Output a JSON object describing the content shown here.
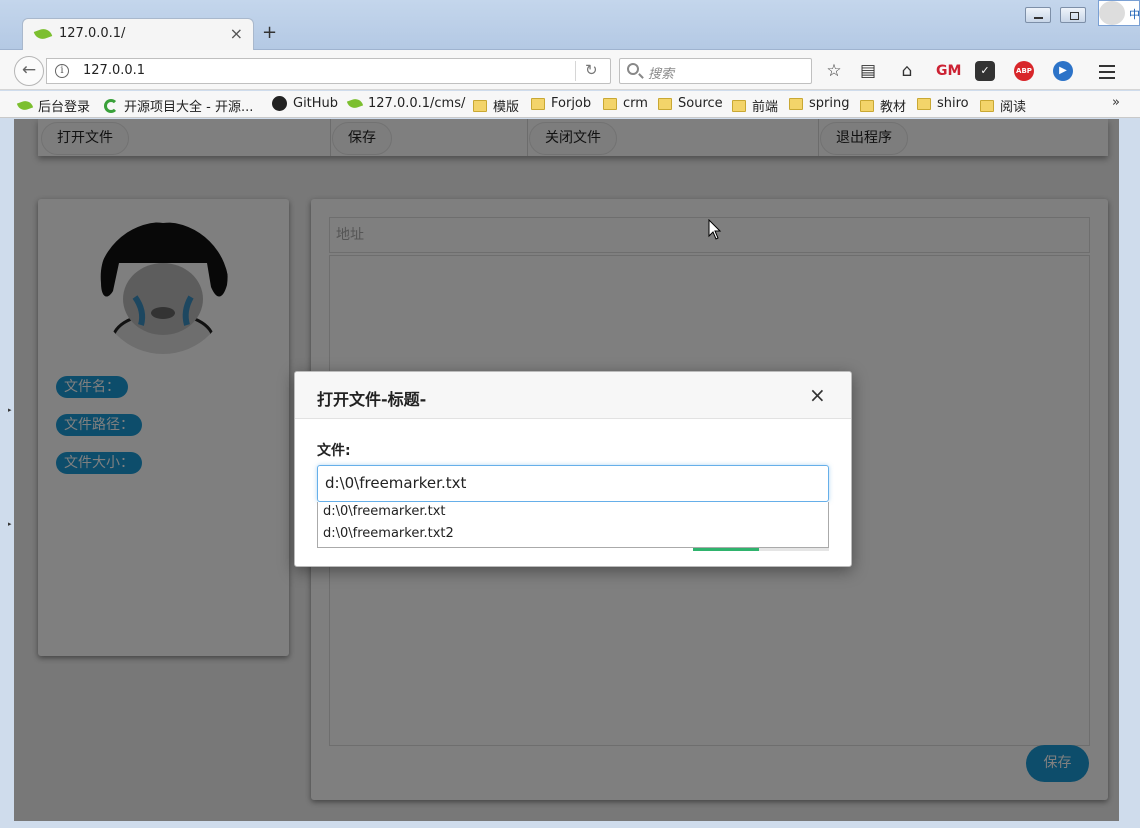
{
  "browser": {
    "tab_title": "127.0.0.1/",
    "tab_close": "×",
    "new_tab": "+",
    "url": "127.0.0.1",
    "search_placeholder": "搜索",
    "ime_char": "中",
    "toolbar_icons": [
      "star-icon",
      "reading-list-icon",
      "home-icon",
      "greasemonkey-icon",
      "pocket-icon",
      "adblock-plus-icon",
      "extension-icon",
      "menu-icon"
    ],
    "abp_label": "ABP",
    "gm_label": "GM"
  },
  "bookmarks": [
    {
      "label": "后台登录",
      "icon": "leaf"
    },
    {
      "label": "开源项目大全 - 开源...",
      "icon": "c"
    },
    {
      "label": "GitHub",
      "icon": "github"
    },
    {
      "label": "127.0.0.1/cms/",
      "icon": "leaf"
    },
    {
      "label": "模版",
      "icon": "folder"
    },
    {
      "label": "Forjob",
      "icon": "folder"
    },
    {
      "label": "crm",
      "icon": "folder"
    },
    {
      "label": "Source",
      "icon": "folder"
    },
    {
      "label": "前端",
      "icon": "folder"
    },
    {
      "label": "spring",
      "icon": "folder"
    },
    {
      "label": "教材",
      "icon": "folder"
    },
    {
      "label": "shiro",
      "icon": "folder"
    },
    {
      "label": "阅读",
      "icon": "folder"
    }
  ],
  "bookmarks_more": "»",
  "topbar": {
    "open_file": "打开文件",
    "save": "保存",
    "close_file": "关闭文件",
    "exit": "退出程序"
  },
  "left_panel": {
    "file_name_label": "文件名：",
    "file_path_label": "文件路径：",
    "file_size_label": "文件大小："
  },
  "right_panel": {
    "address_placeholder": "地址",
    "save_button": "保存"
  },
  "modal": {
    "title": "打开文件-标题-",
    "close": "×",
    "field_label": "文件:",
    "file_value": "d:\\0\\freemarker.txt",
    "suggestions": [
      "d:\\0\\freemarker.txt",
      "d:\\0\\freemarker.txt2"
    ]
  },
  "colors": {
    "accent": "#1a9bd7",
    "confirm": "#2fb36d",
    "focus": "#66afe9"
  }
}
